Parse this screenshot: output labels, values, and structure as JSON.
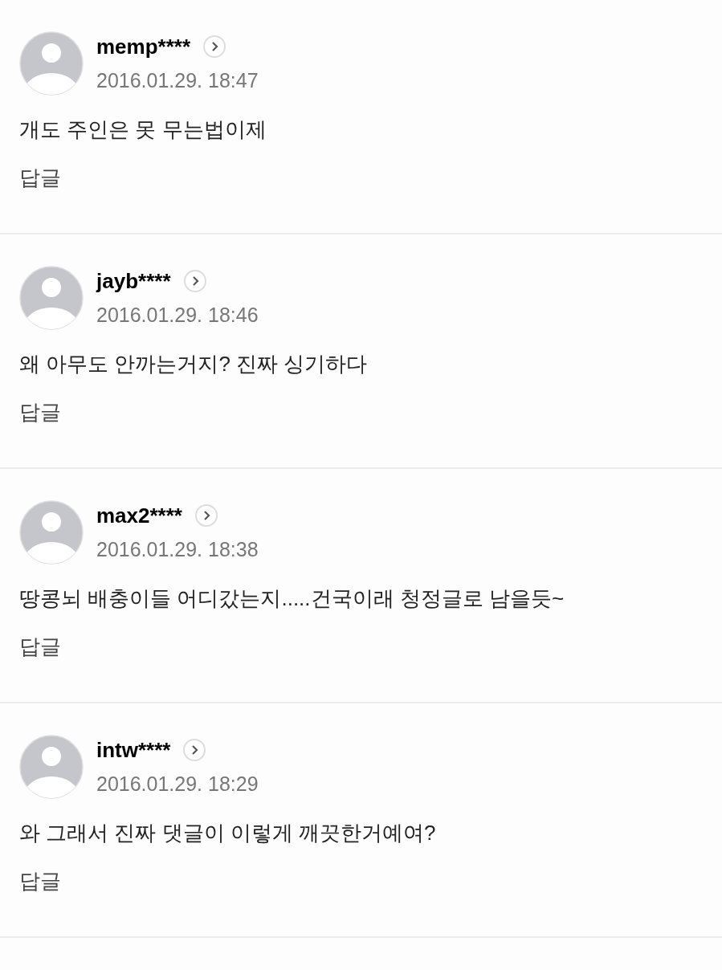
{
  "comments": [
    {
      "username": "memp****",
      "date": "2016.01.29. 18:47",
      "text": "개도 주인은 못 무는법이제",
      "reply": "답글"
    },
    {
      "username": "jayb****",
      "date": "2016.01.29. 18:46",
      "text": "왜 아무도 안까는거지? 진짜 싱기하다",
      "reply": "답글"
    },
    {
      "username": "max2****",
      "date": "2016.01.29. 18:38",
      "text": "땅콩뇌 배충이들 어디갔는지.....건국이래 청정글로 남을듯~",
      "reply": "답글"
    },
    {
      "username": "intw****",
      "date": "2016.01.29. 18:29",
      "text": "와 그래서 진짜 댓글이 이렇게 깨끗한거예여?",
      "reply": "답글"
    }
  ]
}
